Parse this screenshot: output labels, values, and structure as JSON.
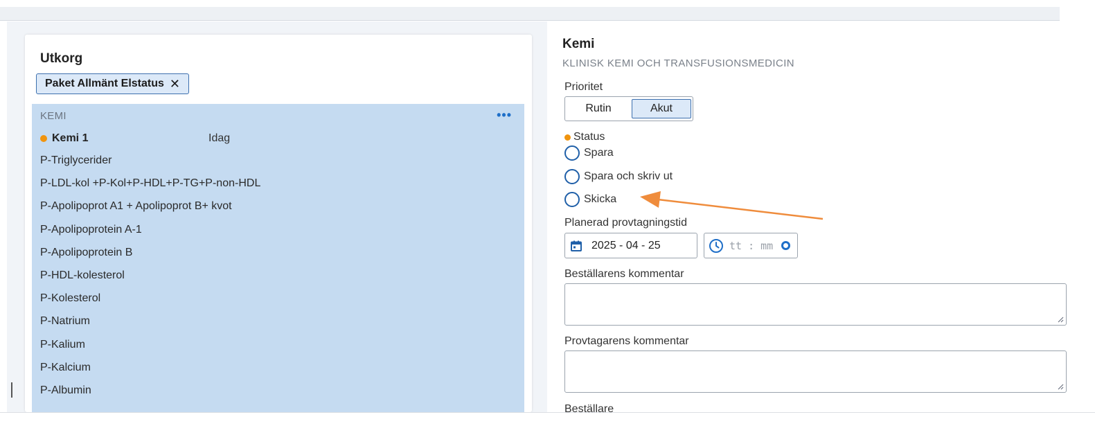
{
  "utkorg": {
    "title": "Utkorg",
    "chip_label": "Paket Allmänt Elstatus",
    "chip_close": "✕",
    "group_label": "KEMI",
    "more_icon": "•••",
    "order_name": "Kemi 1",
    "order_date": "Idag",
    "analyses": [
      "P-Triglycerider",
      "P-LDL-kol +P-Kol+P-HDL+P-TG+P-non-HDL",
      "P-Apolipoprot A1 + Apolipoprot B+ kvot",
      "P-Apolipoprotein A-1",
      "P-Apolipoprotein B",
      "P-HDL-kolesterol",
      "P-Kolesterol",
      "P-Natrium",
      "P-Kalium",
      "P-Kalcium",
      "P-Albumin"
    ]
  },
  "detail": {
    "title": "Kemi",
    "subtitle": "KLINISK KEMI OCH TRANSFUSIONSMEDICIN",
    "priority_label": "Prioritet",
    "priority_options": [
      "Rutin",
      "Akut"
    ],
    "priority_selected": "Akut",
    "status_label": "Status",
    "status_options": [
      "Spara",
      "Spara och skriv ut",
      "Skicka"
    ],
    "planned_label": "Planerad provtagningstid",
    "date_value": "2025 - 04 - 25",
    "time_placeholder": "tt : mm",
    "orderer_comment_label": "Beställarens kommentar",
    "sampler_comment_label": "Provtagarens kommentar",
    "orderer_label": "Beställare"
  },
  "colors": {
    "list_bg": "#c5dbf1",
    "accent": "#1f6fc8",
    "status_dot": "#f0940e",
    "arrow": "#ef8c3c"
  },
  "icons": {
    "more": "more-horizontal-icon",
    "date": "calendar-icon",
    "time": "clock-icon",
    "chip_close": "close-icon"
  }
}
